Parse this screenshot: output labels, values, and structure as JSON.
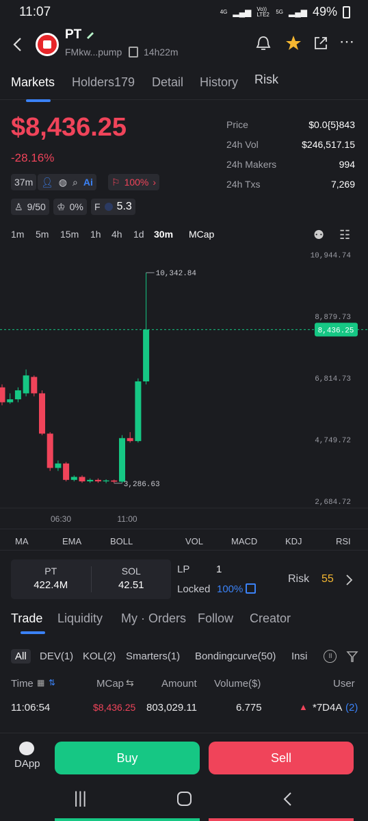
{
  "status": {
    "time": "11:07",
    "net1": "4G",
    "net2": "Vo)) LTE2",
    "net3": "5G",
    "battery": "49%"
  },
  "token": {
    "name": "PT",
    "address": "FMkw...pump",
    "age": "14h22m"
  },
  "tabs": [
    "Markets",
    "Holders179",
    "Detail",
    "History",
    "Risk"
  ],
  "price": "$8,436.25",
  "change": "-28.16%",
  "stats": [
    {
      "label": "Price",
      "value": "$0.0{5}843"
    },
    {
      "label": "24h Vol",
      "value": "$246,517.15"
    },
    {
      "label": "24h Makers",
      "value": "994"
    },
    {
      "label": "24h Txs",
      "value": "7,269"
    }
  ],
  "chips": {
    "age": "37m",
    "sell": "100%",
    "holders": "9/50",
    "dev": "0%",
    "f_label": "F",
    "f_value": "5.3"
  },
  "intervals": [
    "1m",
    "5m",
    "15m",
    "1h",
    "4h",
    "1d",
    "30m",
    "MCap"
  ],
  "chart_data": {
    "type": "candlestick",
    "y_ticks": [
      "10,944.74",
      "8,879.73",
      "6,814.73",
      "4,749.72",
      "2,684.72"
    ],
    "x_ticks": [
      "06:30",
      "11:00"
    ],
    "high_label": "10,342.84",
    "low_label": "3,286.63",
    "current": "8,436.25",
    "candles": [
      {
        "o": 6500,
        "c": 6000,
        "h": 6600,
        "l": 5900
      },
      {
        "o": 6000,
        "c": 6100,
        "h": 6300,
        "l": 5950
      },
      {
        "o": 6100,
        "c": 6400,
        "h": 6500,
        "l": 6000
      },
      {
        "o": 6300,
        "c": 6900,
        "h": 7100,
        "l": 6200
      },
      {
        "o": 6850,
        "c": 6300,
        "h": 6900,
        "l": 6200
      },
      {
        "o": 6300,
        "c": 4950,
        "h": 6400,
        "l": 4900
      },
      {
        "o": 4950,
        "c": 3800,
        "h": 5000,
        "l": 3700
      },
      {
        "o": 3800,
        "c": 3950,
        "h": 4050,
        "l": 3700
      },
      {
        "o": 3950,
        "c": 3400,
        "h": 4000,
        "l": 3350
      },
      {
        "o": 3400,
        "c": 3500,
        "h": 3550,
        "l": 3350
      },
      {
        "o": 3500,
        "c": 3350,
        "h": 3550,
        "l": 3300
      },
      {
        "o": 3350,
        "c": 3400,
        "h": 3450,
        "l": 3300
      },
      {
        "o": 3400,
        "c": 3350,
        "h": 3450,
        "l": 3300
      },
      {
        "o": 3350,
        "c": 3380,
        "h": 3420,
        "l": 3290
      },
      {
        "o": 3380,
        "c": 3340,
        "h": 3410,
        "l": 3287
      },
      {
        "o": 3340,
        "c": 4800,
        "h": 4900,
        "l": 3300
      },
      {
        "o": 4800,
        "c": 4700,
        "h": 5000,
        "l": 4650
      },
      {
        "o": 4700,
        "c": 6700,
        "h": 6800,
        "l": 4650
      },
      {
        "o": 6700,
        "c": 8436,
        "h": 10343,
        "l": 6600
      }
    ]
  },
  "indicators": [
    "MA",
    "EMA",
    "BOLL",
    "VOL",
    "MACD",
    "KDJ",
    "RSI"
  ],
  "lp": {
    "pt_label": "PT",
    "pt_value": "422.4M",
    "sol_label": "SOL",
    "sol_value": "42.51",
    "lp_label": "LP",
    "lp_value": "1",
    "locked_label": "Locked",
    "locked_value": "100%",
    "risk_label": "Risk",
    "risk_value": "55"
  },
  "trade_tabs": [
    "Trade",
    "Liquidity",
    "My · Orders",
    "Follow",
    "Creator"
  ],
  "filters": [
    "All",
    "DEV(1)",
    "KOL(2)",
    "Smarters(1)",
    "Bondingcurve(50)",
    "Insi"
  ],
  "table": {
    "headers": [
      "Time",
      "MCap",
      "Amount",
      "Volume($)",
      "User"
    ],
    "row": {
      "time": "11:06:54",
      "mcap": "$8,436.25",
      "amount": "803,029.11",
      "volume": "6.775",
      "user": "*7D4A",
      "user_count": "(2)"
    }
  },
  "actions": {
    "dapp": "DApp",
    "buy": "Buy",
    "sell": "Sell"
  },
  "colors": {
    "up": "#16c784",
    "down": "#f0445a",
    "accent": "#3b82f6"
  }
}
